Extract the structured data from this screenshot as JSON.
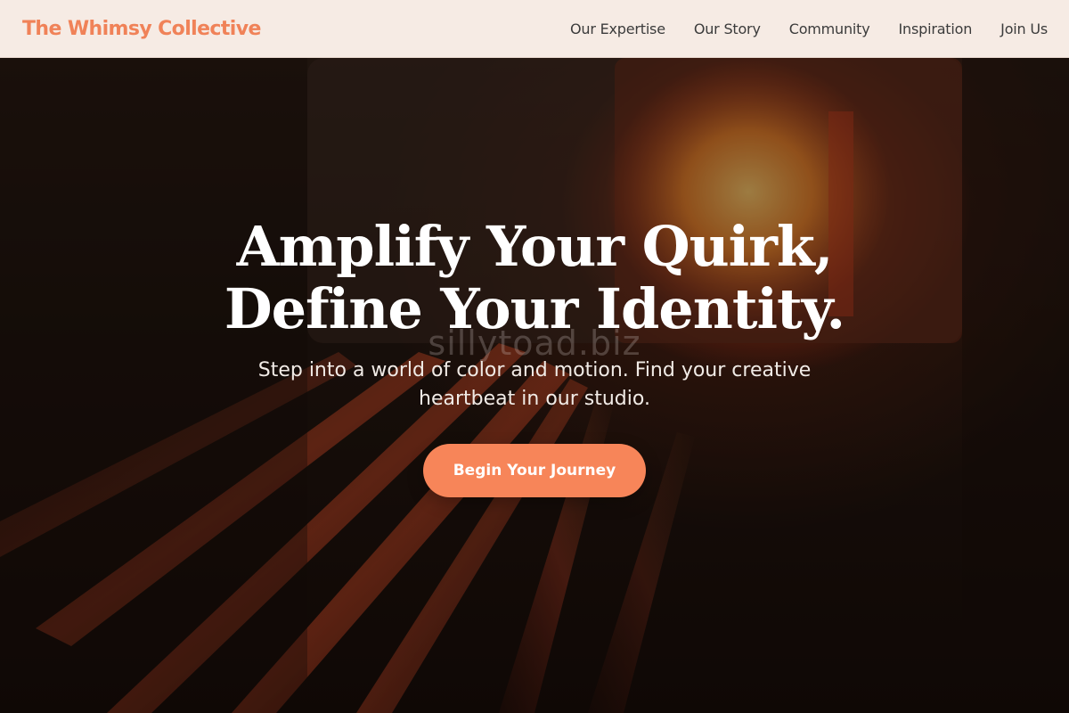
{
  "header": {
    "brand": "The Whimsy Collective",
    "nav": [
      {
        "label": "Our Expertise"
      },
      {
        "label": "Our Story"
      },
      {
        "label": "Community"
      },
      {
        "label": "Inspiration"
      },
      {
        "label": "Join Us"
      }
    ]
  },
  "hero": {
    "title": "Amplify Your Quirk, Define Your Identity.",
    "subtitle": "Step into a world of color and motion. Find your creative heartbeat in our studio.",
    "cta_label": "Begin Your Journey",
    "watermark": "sillytoad.biz"
  },
  "colors": {
    "brand": "#f08258",
    "cta": "#f78559",
    "nav_background": "#f6ebe4",
    "nav_text": "#3b3b3b"
  }
}
